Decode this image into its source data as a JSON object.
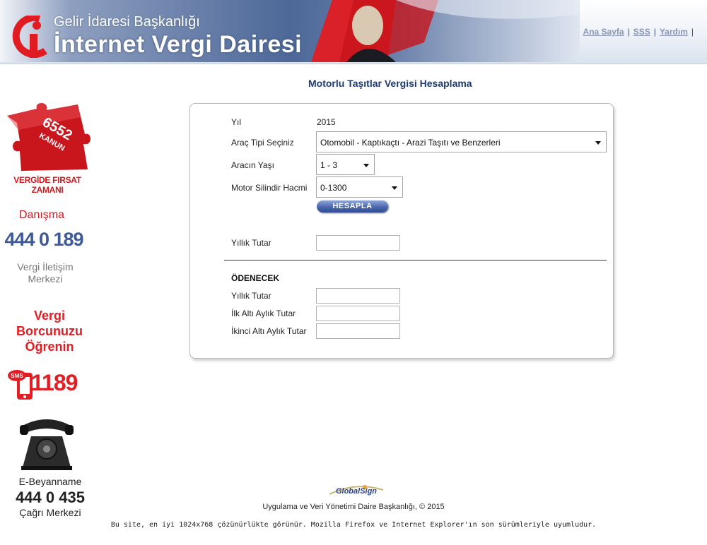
{
  "header": {
    "org_name": "Gelir İdaresi Başkanlığı",
    "app_name": "İnternet Vergi Dairesi",
    "links": [
      "Ana Sayfa",
      "SSS",
      "Yardım"
    ],
    "link_separator": "|"
  },
  "sidebar": {
    "kanun_badge_line1": "6552",
    "kanun_badge_line2": "KANUN",
    "kanun_slogan": "VERGİDE FIRSAT ZAMANI",
    "danisma_title": "Danışma",
    "danisma_phone": "444 0 189",
    "danisma_line1": "Vergi İletişim",
    "danisma_line2": "Merkezi",
    "borc_line1": "Vergi",
    "borc_line2": "Borcunuzu",
    "borc_line3": "Öğrenin",
    "sms_label": "SMS",
    "sms_number": "1189",
    "ebey_title": "E-Beyanname",
    "ebey_phone": "444 0 435",
    "ebey_sub": "Çağrı Merkezi"
  },
  "main": {
    "title": "Motorlu Taşıtlar Vergisi Hesaplama",
    "form": {
      "yil_label": "Yıl",
      "yil_value": "2015",
      "arac_tipi_label": "Araç Tipi Seçiniz",
      "arac_tipi_value": "Otomobil - Kaptıkaçtı - Arazi Taşıtı ve Benzerleri",
      "arac_yasi_label": "Aracın Yaşı",
      "arac_yasi_value": "1 - 3",
      "motor_label": "Motor Silindir Hacmi",
      "motor_value": "0-1300",
      "hesapla_button": "HESAPLA",
      "yillik_tutar_label": "Yıllık Tutar",
      "yillik_tutar_value": "",
      "odenecek_title": "ÖDENECEK",
      "odenecek_yillik_label": "Yıllık Tutar",
      "odenecek_yillik_value": "",
      "ilk_alti_label": "İlk Altı Aylık Tutar",
      "ilk_alti_value": "",
      "ikinci_alti_label": "İkinci Altı Aylık Tutar",
      "ikinci_alti_value": ""
    }
  },
  "footer": {
    "globalsign": "GlobalSign",
    "copyright": "Uygulama ve Veri Yönetimi Daire Başkanlığı, © 2015",
    "browser_note": "Bu site, en iyi 1024x768 çözünürlükte görünür. Mozilla Firefox ve Internet Explorer'ın son sürümleriyle uyumludur."
  },
  "colors": {
    "title_blue": "#1f3a6e",
    "brand_red": "#e21d24",
    "link_gray": "#8b95b6",
    "button_blue": "#4a67ad"
  }
}
